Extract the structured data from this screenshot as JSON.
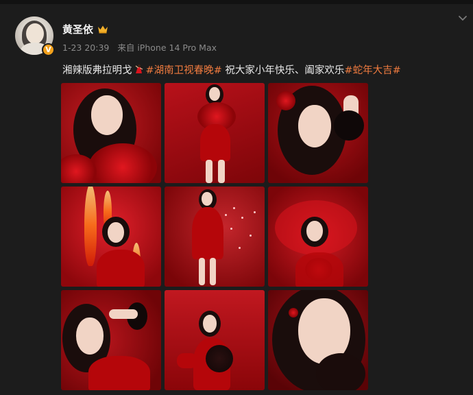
{
  "post": {
    "author": "黄圣依",
    "timestamp": "1-23 20:39",
    "source": "来自 iPhone 14 Pro Max",
    "text_before": "湘辣版弗拉明戈",
    "hashtag_1": "#湖南卫视春晚#",
    "text_middle": " 祝大家小年快乐、阖家欢乐",
    "hashtag_2": "#蛇年大吉#"
  },
  "icons": {
    "avatar_badge": "verified-v-icon",
    "name_badge": "crown-icon",
    "menu": "chevron-down-icon",
    "inline_emoji": "flamenco-dancer-emoji"
  },
  "colors": {
    "background": "#1c1c1c",
    "hashtag": "#f07b3f",
    "badge": "#f3a11c",
    "meta_text": "#8a8a8a"
  },
  "photos": [
    {
      "id": "photo-1",
      "subject": "portrait with red rose dress"
    },
    {
      "id": "photo-2",
      "subject": "full-body red sequin dress"
    },
    {
      "id": "photo-3",
      "subject": "portrait with red headpiece and fan"
    },
    {
      "id": "photo-4",
      "subject": "flames background"
    },
    {
      "id": "photo-5",
      "subject": "sparkling red dress"
    },
    {
      "id": "photo-6",
      "subject": "red veil"
    },
    {
      "id": "photo-7",
      "subject": "reclining portrait"
    },
    {
      "id": "photo-8",
      "subject": "red fan and gloves"
    },
    {
      "id": "photo-9",
      "subject": "close-up portrait with red earring"
    }
  ]
}
